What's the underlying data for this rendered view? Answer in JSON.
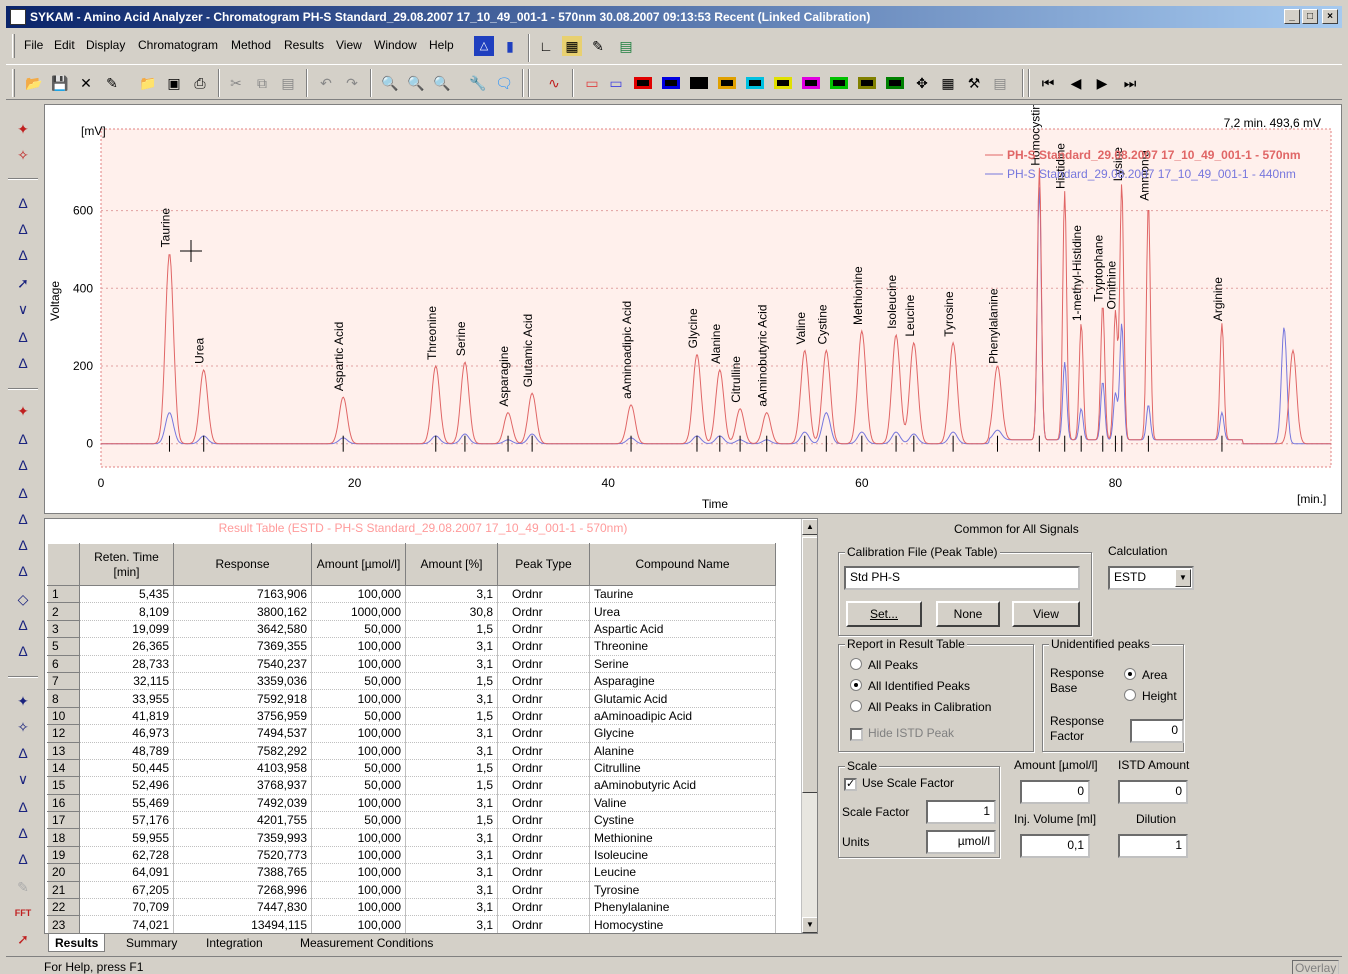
{
  "window": {
    "title": "SYKAM - Amino Acid Analyzer - Chromatogram PH-S Standard_29.08.2007 17_10_49_001-1 - 570nm 30.08.2007 09:13:53 Recent (Linked Calibration)",
    "min": "_",
    "max": "□",
    "close": "×"
  },
  "menu": [
    "File",
    "Edit",
    "Display",
    "Chromatogram",
    "Method",
    "Results",
    "View",
    "Window",
    "Help"
  ],
  "chart_data": {
    "type": "line",
    "xlabel": "Time",
    "ylabel": "Voltage",
    "x_unit": "[min.]",
    "y_unit": "[mV]",
    "cursor_readout": "7,2 min.  493,6 mV",
    "xlim": [
      0,
      97
    ],
    "ylim": [
      -60,
      810
    ],
    "xticks": [
      0,
      20,
      40,
      60,
      80
    ],
    "yticks": [
      0,
      200,
      400,
      600
    ],
    "background": "#fff0ec",
    "series": [
      {
        "name": "PH-S Standard_29.08.2007 17_10_49_001-1 - 570nm",
        "color": "#e06666"
      },
      {
        "name": "PH-S Standard_29.08.2007 17_10_49_001-1 - 440nm",
        "color": "#7777dd"
      }
    ],
    "peaks": [
      {
        "label": "Taurine",
        "t": 5.4,
        "h": 490,
        "h2": 80
      },
      {
        "label": "Urea",
        "t": 8.1,
        "h": 190,
        "h2": 20
      },
      {
        "label": "Aspartic Acid",
        "t": 19.1,
        "h": 120,
        "h2": 15
      },
      {
        "label": "Threonine",
        "t": 26.4,
        "h": 200,
        "h2": 20
      },
      {
        "label": "Serine",
        "t": 28.7,
        "h": 210,
        "h2": 25
      },
      {
        "label": "Asparagine",
        "t": 32.1,
        "h": 80,
        "h2": 10
      },
      {
        "label": "Glutamic Acid",
        "t": 34.0,
        "h": 130,
        "h2": 25
      },
      {
        "label": "aAminoadipic Acid",
        "t": 41.8,
        "h": 100,
        "h2": 15
      },
      {
        "label": "Glycine",
        "t": 47.0,
        "h": 230,
        "h2": 20
      },
      {
        "label": "Alanine",
        "t": 48.8,
        "h": 190,
        "h2": 20
      },
      {
        "label": "Citrulline",
        "t": 50.4,
        "h": 90,
        "h2": 10
      },
      {
        "label": "aAminobutyric Acid",
        "t": 52.5,
        "h": 80,
        "h2": 10
      },
      {
        "label": "Valine",
        "t": 55.5,
        "h": 240,
        "h2": 30
      },
      {
        "label": "Cystine",
        "t": 57.2,
        "h": 240,
        "h2": 80
      },
      {
        "label": "Methionine",
        "t": 60.0,
        "h": 290,
        "h2": 30
      },
      {
        "label": "Isoleucine",
        "t": 62.7,
        "h": 280,
        "h2": 30
      },
      {
        "label": "Leucine",
        "t": 64.1,
        "h": 260,
        "h2": 25
      },
      {
        "label": "Tyrosine",
        "t": 67.2,
        "h": 260,
        "h2": 30
      },
      {
        "label": "Phenylalanine",
        "t": 70.7,
        "h": 190,
        "h2": 25
      },
      {
        "label": "Homocystine",
        "t": 74.0,
        "h": 700,
        "h2": 650
      },
      {
        "label": "Histidine",
        "t": 76.0,
        "h": 640,
        "h2": 200
      },
      {
        "label": "1-methyl-Histidine",
        "t": 77.3,
        "h": 300,
        "h2": 80
      },
      {
        "label": "Tryptophane",
        "t": 79.0,
        "h": 350,
        "h2": 150
      },
      {
        "label": "Ornithine",
        "t": 80.0,
        "h": 330,
        "h2": 120
      },
      {
        "label": "Lysine",
        "t": 80.5,
        "h": 660,
        "h2": 300
      },
      {
        "label": "Ammonia",
        "t": 82.6,
        "h": 610,
        "h2": 90
      },
      {
        "label": "Arginine",
        "t": 88.4,
        "h": 300,
        "h2": 70
      }
    ]
  },
  "table": {
    "caption": "Result Table (ESTD - PH-S Standard_29.08.2007 17_10_49_001-1 - 570nm)",
    "headers": [
      "Reten. Time [min]",
      "Response",
      "Amount [µmol/l]",
      "Amount [%]",
      "Peak Type",
      "Compound Name"
    ],
    "rows": [
      {
        "n": "1",
        "t": "5,435",
        "r": "7163,906",
        "a": "100,000",
        "p": "3,1",
        "pt": "Ordnr",
        "c": "Taurine"
      },
      {
        "n": "2",
        "t": "8,109",
        "r": "3800,162",
        "a": "1000,000",
        "p": "30,8",
        "pt": "Ordnr",
        "c": "Urea"
      },
      {
        "n": "3",
        "t": "19,099",
        "r": "3642,580",
        "a": "50,000",
        "p": "1,5",
        "pt": "Ordnr",
        "c": "Aspartic Acid"
      },
      {
        "n": "5",
        "t": "26,365",
        "r": "7369,355",
        "a": "100,000",
        "p": "3,1",
        "pt": "Ordnr",
        "c": "Threonine"
      },
      {
        "n": "6",
        "t": "28,733",
        "r": "7540,237",
        "a": "100,000",
        "p": "3,1",
        "pt": "Ordnr",
        "c": "Serine"
      },
      {
        "n": "7",
        "t": "32,115",
        "r": "3359,036",
        "a": "50,000",
        "p": "1,5",
        "pt": "Ordnr",
        "c": "Asparagine"
      },
      {
        "n": "8",
        "t": "33,955",
        "r": "7592,918",
        "a": "100,000",
        "p": "3,1",
        "pt": "Ordnr",
        "c": "Glutamic Acid"
      },
      {
        "n": "10",
        "t": "41,819",
        "r": "3756,959",
        "a": "50,000",
        "p": "1,5",
        "pt": "Ordnr",
        "c": "aAminoadipic Acid"
      },
      {
        "n": "12",
        "t": "46,973",
        "r": "7494,537",
        "a": "100,000",
        "p": "3,1",
        "pt": "Ordnr",
        "c": "Glycine"
      },
      {
        "n": "13",
        "t": "48,789",
        "r": "7582,292",
        "a": "100,000",
        "p": "3,1",
        "pt": "Ordnr",
        "c": "Alanine"
      },
      {
        "n": "14",
        "t": "50,445",
        "r": "4103,958",
        "a": "50,000",
        "p": "1,5",
        "pt": "Ordnr",
        "c": "Citrulline"
      },
      {
        "n": "15",
        "t": "52,496",
        "r": "3768,937",
        "a": "50,000",
        "p": "1,5",
        "pt": "Ordnr",
        "c": "aAminobutyric Acid"
      },
      {
        "n": "16",
        "t": "55,469",
        "r": "7492,039",
        "a": "100,000",
        "p": "3,1",
        "pt": "Ordnr",
        "c": "Valine"
      },
      {
        "n": "17",
        "t": "57,176",
        "r": "4201,755",
        "a": "50,000",
        "p": "1,5",
        "pt": "Ordnr",
        "c": "Cystine"
      },
      {
        "n": "18",
        "t": "59,955",
        "r": "7359,993",
        "a": "100,000",
        "p": "3,1",
        "pt": "Ordnr",
        "c": "Methionine"
      },
      {
        "n": "19",
        "t": "62,728",
        "r": "7520,773",
        "a": "100,000",
        "p": "3,1",
        "pt": "Ordnr",
        "c": "Isoleucine"
      },
      {
        "n": "20",
        "t": "64,091",
        "r": "7388,765",
        "a": "100,000",
        "p": "3,1",
        "pt": "Ordnr",
        "c": "Leucine"
      },
      {
        "n": "21",
        "t": "67,205",
        "r": "7268,996",
        "a": "100,000",
        "p": "3,1",
        "pt": "Ordnr",
        "c": "Tyrosine"
      },
      {
        "n": "22",
        "t": "70,709",
        "r": "7447,830",
        "a": "100,000",
        "p": "3,1",
        "pt": "Ordnr",
        "c": "Phenylalanine"
      },
      {
        "n": "23",
        "t": "74,021",
        "r": "13494,115",
        "a": "100,000",
        "p": "3,1",
        "pt": "Ordnr",
        "c": "Homocystine"
      }
    ]
  },
  "tabs": [
    "Results",
    "Summary",
    "Integration",
    "Measurement Conditions"
  ],
  "status": {
    "help": "For Help, press F1",
    "mode": "Overlay"
  },
  "right": {
    "title": "Common for All Signals",
    "calibration_group": "Calibration File (Peak Table)",
    "calibration_file": "Std PH-S",
    "set_btn": "Set...",
    "none_btn": "None",
    "view_btn": "View",
    "calculation_label": "Calculation",
    "calculation_value": "ESTD",
    "report_group": "Report in Result Table",
    "report_all": "All Peaks",
    "report_identified": "All Identified Peaks",
    "report_calibration": "All Peaks in Calibration",
    "hide_istd": "Hide ISTD Peak",
    "unidentified_group": "Unidentified peaks",
    "response_base": "Response Base",
    "area": "Area",
    "height": "Height",
    "response_factor": "Response Factor",
    "response_factor_value": "0",
    "scale_group": "Scale",
    "use_scale": "Use Scale Factor",
    "scale_factor_label": "Scale Factor",
    "scale_factor_value": "1",
    "units_label": "Units",
    "units_value": "µmol/l",
    "amount_label": "Amount [µmol/l]",
    "amount_value": "0",
    "istd_label": "ISTD Amount",
    "istd_value": "0",
    "inj_label": "Inj. Volume [ml]",
    "inj_value": "0,1",
    "dilution_label": "Dilution",
    "dilution_value": "1"
  }
}
